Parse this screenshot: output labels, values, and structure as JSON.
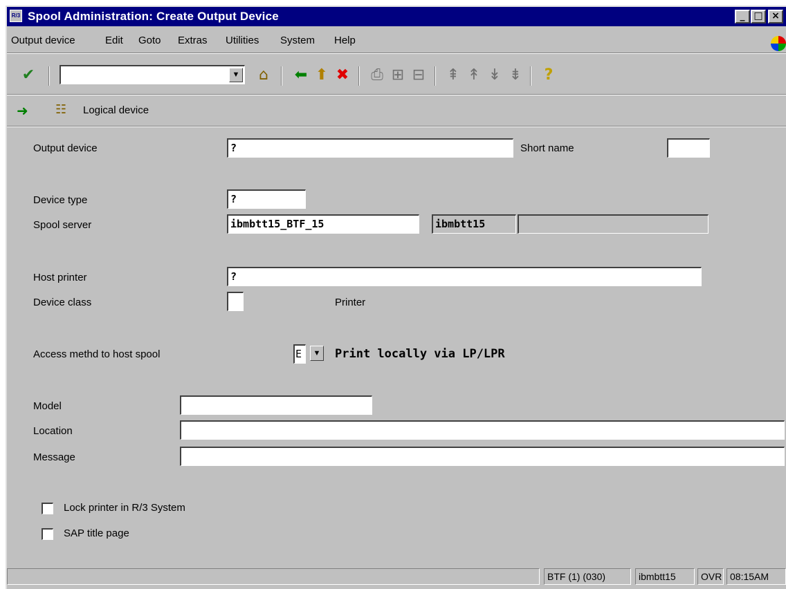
{
  "window": {
    "title": "Spool Administration: Create Output Device",
    "icon_text": "R/3"
  },
  "menu": [
    "Output device",
    "Edit",
    "Goto",
    "Extras",
    "Utilities",
    "System",
    "Help"
  ],
  "toolbar": {
    "command_field_value": "",
    "icons": [
      "enter-check-icon",
      "save-icon",
      "back-icon",
      "exit-icon",
      "cancel-icon",
      "print-icon",
      "find-icon",
      "find-next-icon",
      "first-page-icon",
      "previous-page-icon",
      "next-page-icon",
      "last-page-icon",
      "help-icon"
    ]
  },
  "app_toolbar": {
    "label": "Logical device"
  },
  "form": {
    "output_device": {
      "label": "Output device",
      "value": "?"
    },
    "short_name": {
      "label": "Short name",
      "value": ""
    },
    "device_type": {
      "label": "Device type",
      "value": "?"
    },
    "spool_server": {
      "label": "Spool server",
      "value": "ibmbtt15_BTF_15",
      "host": "ibmbtt15",
      "extra": ""
    },
    "host_printer": {
      "label": "Host printer",
      "value": "?"
    },
    "device_class": {
      "label": "Device class",
      "value": "",
      "description": "Printer"
    },
    "access_method": {
      "label": "Access methd to host spool",
      "value": "E",
      "description": "Print locally via LP/LPR"
    },
    "model": {
      "label": "Model",
      "value": ""
    },
    "location": {
      "label": "Location",
      "value": ""
    },
    "message": {
      "label": "Message",
      "value": ""
    },
    "lock_printer": {
      "label": "Lock printer in R/3 System",
      "checked": false
    },
    "sap_title_page": {
      "label": "SAP title page",
      "checked": false
    }
  },
  "status": {
    "message": "",
    "system": "BTF (1) (030)",
    "server": "ibmbtt15",
    "mode": "OVR",
    "time": "08:15AM"
  }
}
